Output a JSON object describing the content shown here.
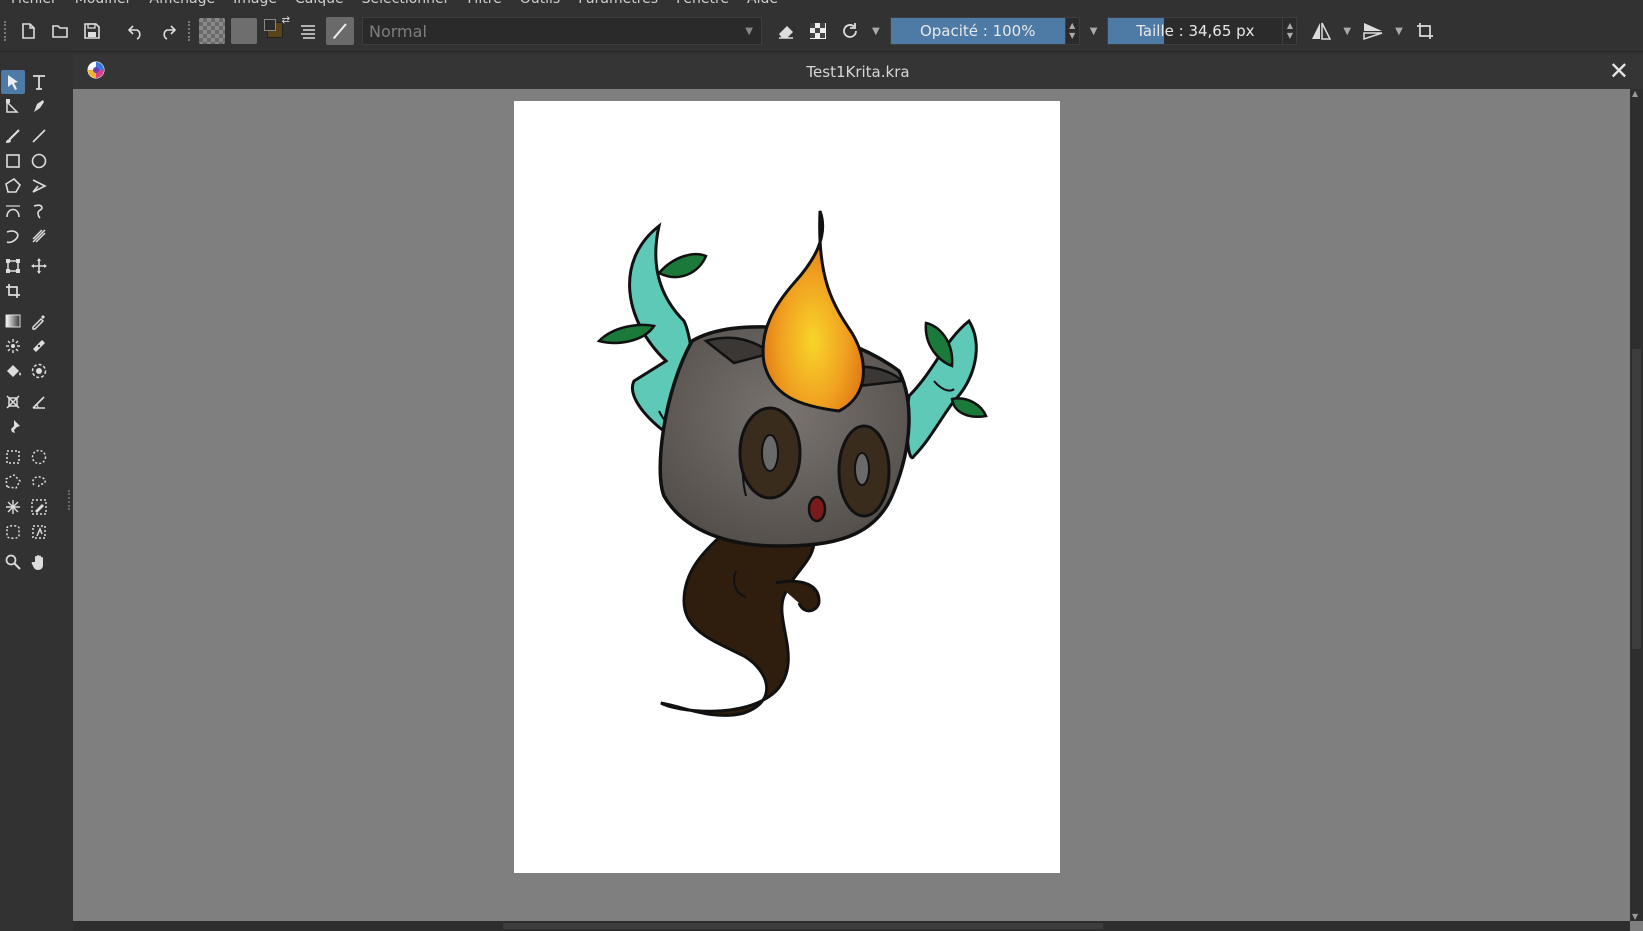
{
  "menu": [
    "Fichier",
    "Modifier",
    "Affichage",
    "Image",
    "Calque",
    "Sélectionner",
    "Filtre",
    "Outils",
    "Paramètres",
    "Fenêtre",
    "Aide"
  ],
  "toolbar": {
    "blend_mode": "Normal",
    "opacity_label": "Opacité : 100%",
    "opacity_value": 1.0,
    "size_label": "Taille : 34,65 px",
    "size_fill_fraction": 0.32
  },
  "document": {
    "title": "Test1Krita.kra"
  },
  "colors": {
    "accent": "#4e7aa6",
    "canvas_bg": "#7f7f7f",
    "paper": "#ffffff",
    "foreground_color": "#3a2d16",
    "background_color": "#111111"
  },
  "icons": {
    "toolbar": [
      "new-document-icon",
      "open-folder-icon",
      "save-icon",
      "undo-icon",
      "redo-icon",
      "gradient-swatch-icon",
      "pattern-swatch-icon",
      "color-swap-icon",
      "layer-stack-icon",
      "brush-preset-icon",
      "eraser-icon",
      "transparency-checker-icon",
      "reload-icon",
      "mirror-horizontal-icon",
      "mirror-vertical-icon",
      "wrap-around-icon"
    ],
    "tools": [
      "select-shape-icon",
      "text-icon",
      "edit-shapes-icon",
      "calligraphy-icon",
      "freehand-brush-icon",
      "line-icon",
      "rectangle-icon",
      "ellipse-icon",
      "polygon-icon",
      "polyline-icon",
      "bezier-curve-icon",
      "freehand-path-icon",
      "dynamic-brush-icon",
      "multibrush-icon",
      "transform-icon",
      "move-icon",
      "crop-icon",
      "gradient-icon",
      "color-sampler-icon",
      "colorize-mask-icon",
      "smart-patch-icon",
      "fill-icon",
      "enclose-fill-icon",
      "assistant-icon",
      "measure-icon",
      "reference-pin-icon",
      "rectangular-selection-icon",
      "elliptical-selection-icon",
      "polygonal-selection-icon",
      "freehand-selection-icon",
      "contiguous-selection-icon",
      "similar-selection-icon",
      "bezier-selection-icon",
      "magnetic-selection-icon",
      "zoom-icon",
      "pan-hand-icon"
    ]
  }
}
